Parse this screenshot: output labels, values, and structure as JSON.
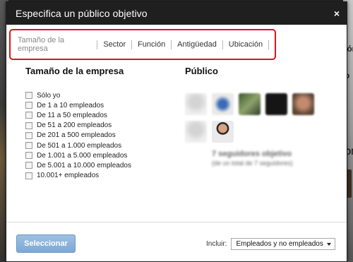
{
  "dialog": {
    "title": "Especifica un público objetivo",
    "close_glyph": "×"
  },
  "tabs": [
    {
      "label": "Tamaño de la empresa",
      "active": true
    },
    {
      "label": "Sector",
      "active": false
    },
    {
      "label": "Función",
      "active": false
    },
    {
      "label": "Antigüedad",
      "active": false
    },
    {
      "label": "Ubicación",
      "active": false
    }
  ],
  "company_size": {
    "heading": "Tamaño de la empresa",
    "options": [
      "Sólo yo",
      "De 1 a 10 empleados",
      "De 11 a 50 empleados",
      "De 51 a 200 empleados",
      "De 201 a 500 empleados",
      "De 501 a 1.000 empleados",
      "De 1.001 a 5.000 empleados",
      "De 5.001 a 10.000 empleados",
      "10.001+ empleados"
    ]
  },
  "audience": {
    "heading": "Público",
    "followers_count": "7 seguidores objetivo",
    "followers_sub": "(de un total de 7 seguidores)"
  },
  "footer": {
    "select_button": "Seleccionar",
    "include_label": "Incluir:",
    "include_value": "Empleados y no empleados"
  },
  "background": {
    "right_letters": [
      "ión",
      "o",
      "ON"
    ]
  },
  "colors": {
    "titlebar": "#1f1f1f",
    "highlight_border": "#e0121b",
    "primary_button": "#8bb4dc"
  }
}
